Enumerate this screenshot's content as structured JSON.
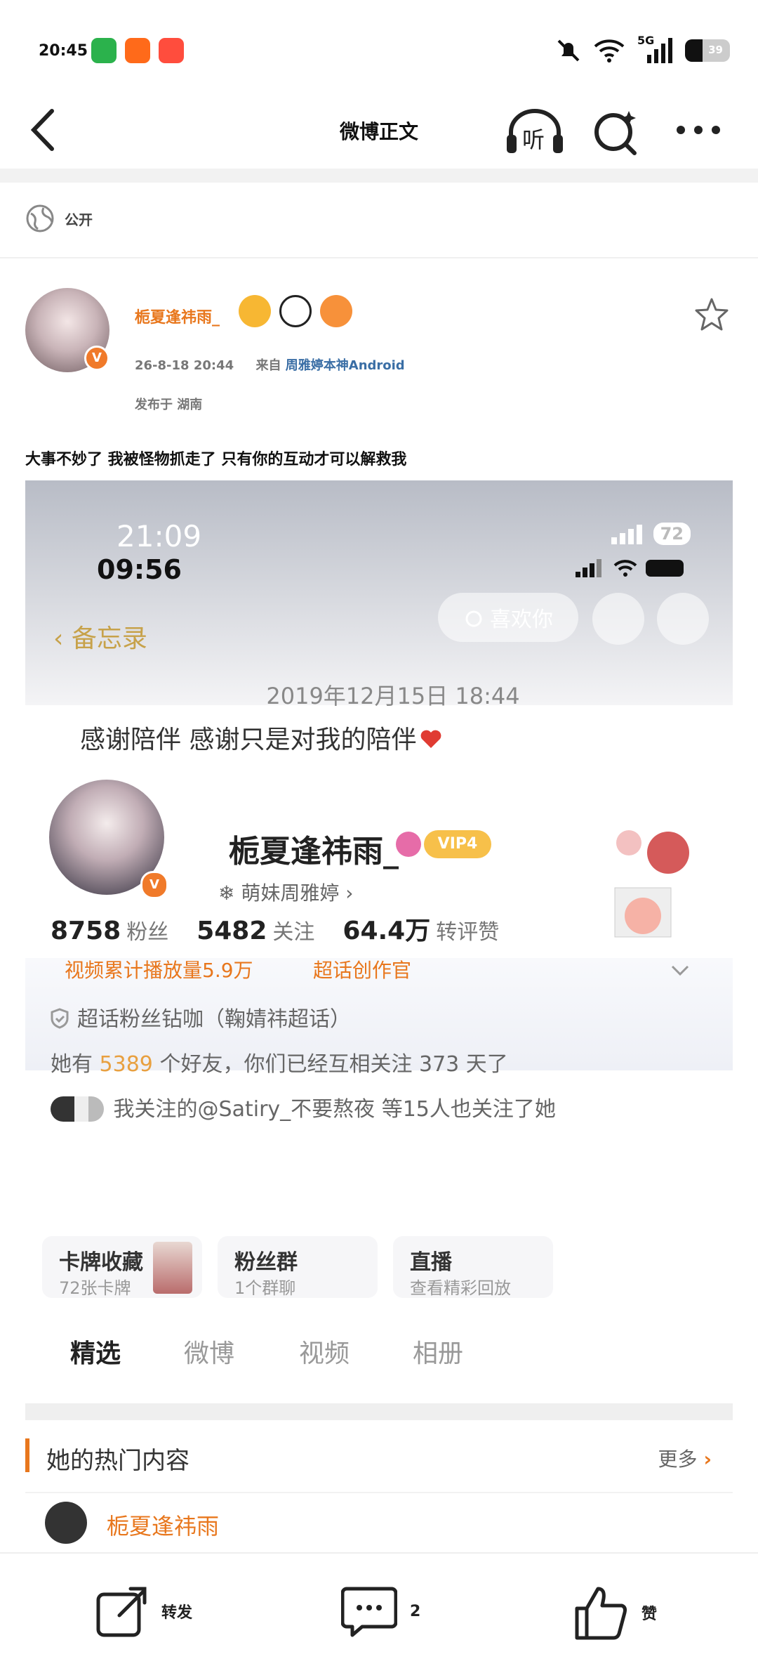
{
  "status_bar": {
    "time": "20:45",
    "network": "5G",
    "battery_level": "39",
    "battery_fraction": 0.39
  },
  "nav": {
    "title": "微博正文",
    "listen_label": "听"
  },
  "post": {
    "visibility": "公开",
    "author": "栀夏逢祎雨_",
    "timestamp": "26-8-18 20:44",
    "source_prefix": "来自",
    "source": "周雅婷本神Android",
    "location": "发布于 湖南",
    "text": "大事不妙了 我被怪物抓走了 只有你的互动才可以解救我"
  },
  "embedded": {
    "time_top": "21:09",
    "time_bottom": "09:56",
    "battery_pill": "72",
    "memo_back": "备忘录",
    "like_label": "喜欢你",
    "memo_date": "2019年12月15日 18:44",
    "memo_text": "感谢陪伴 感谢只是对我的陪伴",
    "profile_name": "栀夏逢祎雨_",
    "vip": "VIP4",
    "tag": "萌妹周雅婷",
    "stats": [
      {
        "value": "8758",
        "label": "粉丝"
      },
      {
        "value": "5482",
        "label": "关注"
      },
      {
        "value": "64.4万",
        "label": "转评赞"
      }
    ],
    "video_plays": "视频累计播放量5.9万",
    "creator": "超话创作官",
    "supertopic": "超话粉丝钻咖（鞠婧祎超话）",
    "friends_prefix": "她有",
    "friends_count": "5389",
    "friends_suffix": "个好友，你们已经互相关注 373 天了",
    "mutual": "我关注的@Satiry_不要熬夜 等15人也关注了她",
    "cards": [
      {
        "title": "卡牌收藏",
        "sub": "72张卡牌"
      },
      {
        "title": "粉丝群",
        "sub": "1个群聊"
      },
      {
        "title": "直播",
        "sub": "查看精彩回放"
      }
    ],
    "tabs": [
      "精选",
      "微博",
      "视频",
      "相册"
    ],
    "hot_title": "她的热门内容",
    "hot_more": "更多",
    "next_author": "栀夏逢祎雨"
  },
  "actions": {
    "repost": "转发",
    "comment_count": "2",
    "like": "赞"
  },
  "colors": {
    "accent": "#e8771d",
    "link": "#3a6ea5",
    "vip": "#f7c04a"
  }
}
